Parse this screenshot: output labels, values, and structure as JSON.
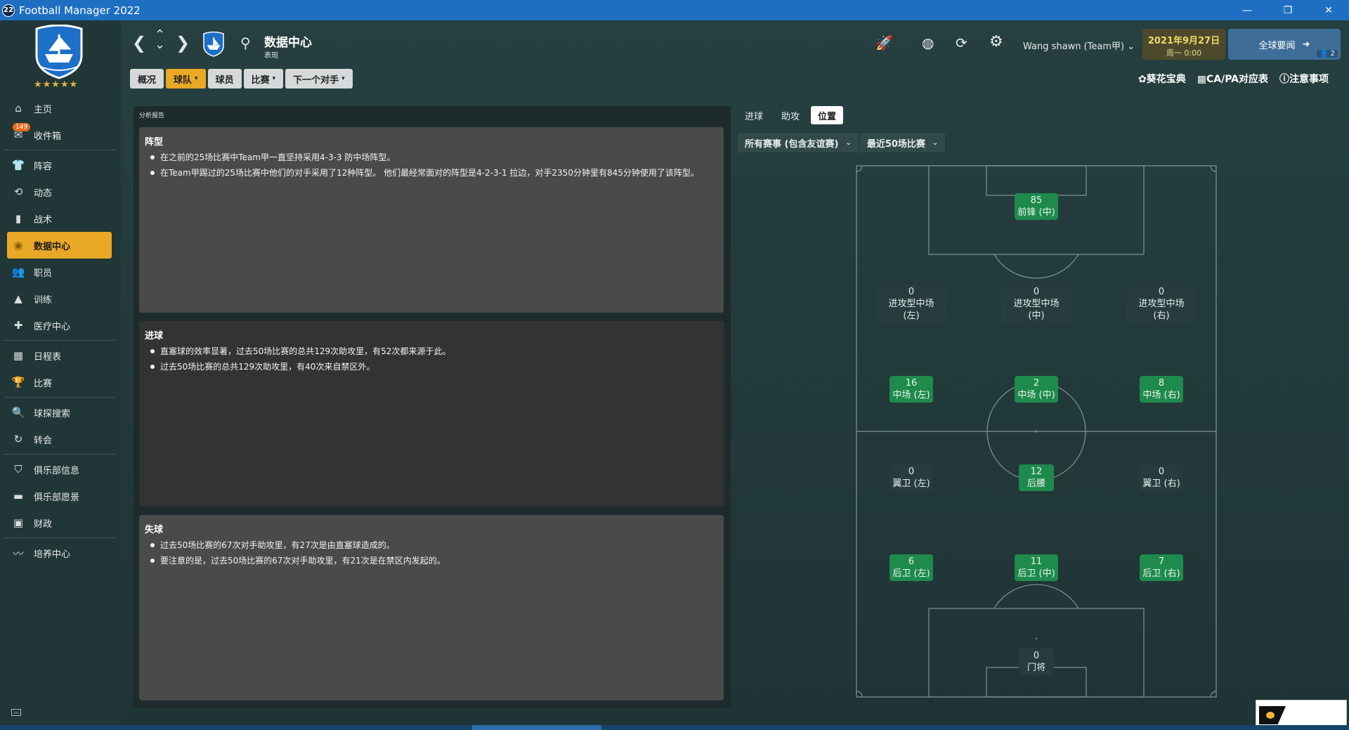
{
  "window": {
    "app_icon_text": "22",
    "title": "Football Manager 2022",
    "controls": [
      "—",
      "❐",
      "✕"
    ]
  },
  "sidebar": {
    "rating_stars": "★★★★★",
    "inbox_badge": "149",
    "items": [
      {
        "label": "主页",
        "icon": "home-icon"
      },
      {
        "label": "收件箱",
        "icon": "inbox-icon"
      },
      {
        "label": "阵容",
        "icon": "squad-icon"
      },
      {
        "label": "动态",
        "icon": "dynamics-icon"
      },
      {
        "label": "战术",
        "icon": "tactics-icon"
      },
      {
        "label": "数据中心",
        "icon": "data-hub-icon",
        "active": true
      },
      {
        "label": "职员",
        "icon": "staff-icon"
      },
      {
        "label": "训练",
        "icon": "training-icon"
      },
      {
        "label": "医疗中心",
        "icon": "medical-icon"
      },
      {
        "label": "日程表",
        "icon": "calendar-icon"
      },
      {
        "label": "比赛",
        "icon": "trophy-icon"
      },
      {
        "label": "球探搜索",
        "icon": "scouting-icon"
      },
      {
        "label": "转会",
        "icon": "transfers-icon"
      },
      {
        "label": "俱乐部信息",
        "icon": "club-info-icon"
      },
      {
        "label": "俱乐部愿景",
        "icon": "club-vision-icon"
      },
      {
        "label": "财政",
        "icon": "finances-icon"
      },
      {
        "label": "培养中心",
        "icon": "development-icon"
      }
    ]
  },
  "header": {
    "title": "数据中心",
    "subtitle": "表现",
    "user": "Wang shawn (Team甲)",
    "date": "2021年9月27日",
    "time": "周一 0:00",
    "news_label": "全球要闻",
    "news_count": "2"
  },
  "subnav": {
    "tabs": [
      {
        "label": "概况",
        "dropdown": false,
        "active": false
      },
      {
        "label": "球队",
        "dropdown": true,
        "active": true
      },
      {
        "label": "球员",
        "dropdown": false,
        "active": false
      },
      {
        "label": "比赛",
        "dropdown": true,
        "active": false
      },
      {
        "label": "下一个对手",
        "dropdown": true,
        "active": false
      }
    ]
  },
  "quicklinks": [
    "葵花宝典",
    "CA/PA对应表",
    "注意事项"
  ],
  "report": {
    "title": "分析报告",
    "sections": [
      {
        "heading": "阵型",
        "bullets": [
          "在之前的25场比赛中Team甲一直坚持采用4-3-3 防中场阵型。",
          "在Team甲踢过的25场比赛中他们的对手采用了12种阵型。 他们最经常面对的阵型是4-2-3-1 拉边，对手2350分钟里有845分钟使用了该阵型。"
        ]
      },
      {
        "heading": "进球",
        "bullets": [
          "直塞球的效率显著，过去50场比赛的总共129次助攻里，有52次都来源于此。",
          "过去50场比赛的总共129次助攻里，有40次来自禁区外。"
        ]
      },
      {
        "heading": "失球",
        "bullets": [
          "过去50场比赛的67次对手助攻里，有27次是由直塞球造成的。",
          "要注意的是，过去50场比赛的67次对手助攻里，有21次是在禁区内发起的。"
        ]
      }
    ]
  },
  "panel": {
    "tabs": [
      "进球",
      "助攻",
      "位置"
    ],
    "active_tab": "位置",
    "filter_competition": "所有赛事 (包含友谊赛)",
    "filter_range": "最近50场比赛"
  },
  "positions": [
    {
      "key": "st",
      "value": "85",
      "label": "前锋 (中)",
      "hot": true
    },
    {
      "key": "aml",
      "value": "0",
      "label": "进攻型中场 (左)",
      "hot": false
    },
    {
      "key": "amc",
      "value": "0",
      "label": "进攻型中场 (中)",
      "hot": false
    },
    {
      "key": "amr",
      "value": "0",
      "label": "进攻型中场 (右)",
      "hot": false
    },
    {
      "key": "ml",
      "value": "16",
      "label": "中场 (左)",
      "hot": true
    },
    {
      "key": "mc",
      "value": "2",
      "label": "中场 (中)",
      "hot": true
    },
    {
      "key": "mr",
      "value": "8",
      "label": "中场 (右)",
      "hot": true
    },
    {
      "key": "wbl",
      "value": "0",
      "label": "翼卫 (左)",
      "hot": false
    },
    {
      "key": "dm",
      "value": "12",
      "label": "后腰",
      "hot": true
    },
    {
      "key": "wbr",
      "value": "0",
      "label": "翼卫 (右)",
      "hot": false
    },
    {
      "key": "dl",
      "value": "6",
      "label": "后卫 (左)",
      "hot": true
    },
    {
      "key": "dc",
      "value": "11",
      "label": "后卫 (中)",
      "hot": true
    },
    {
      "key": "dr",
      "value": "7",
      "label": "后卫 (右)",
      "hot": true
    },
    {
      "key": "gk",
      "value": "0",
      "label": "门将",
      "hot": false
    }
  ],
  "colors": {
    "accent": "#e9a825",
    "hot_position": "#1e8a4c",
    "title_bar": "#1e6fc2"
  }
}
